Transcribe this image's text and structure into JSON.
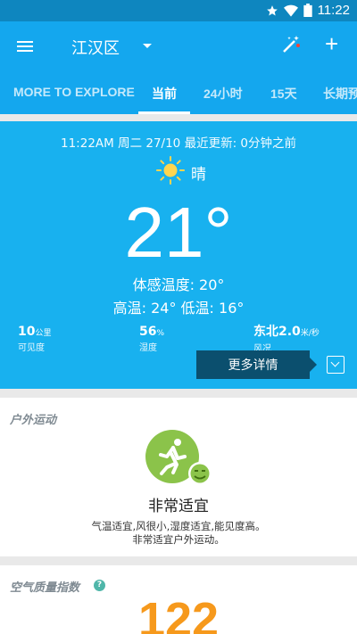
{
  "status_bar": {
    "time": "11:22",
    "icons": [
      "star-icon",
      "wifi-icon",
      "battery-icon"
    ]
  },
  "app_bar": {
    "city": "江汉区",
    "add_label": "+"
  },
  "tabs": [
    {
      "label": "MORE TO EXPLORE",
      "active": false
    },
    {
      "label": "当前",
      "active": true
    },
    {
      "label": "24小时",
      "active": false
    },
    {
      "label": "15天",
      "active": false
    },
    {
      "label": "长期预",
      "active": false
    }
  ],
  "current": {
    "updated": "11:22AM 周二 27/10 最近更新: 0分钟之前",
    "condition": "晴",
    "temperature": "21°",
    "feels_like": "体感温度: 20°",
    "high_low": "高温: 24° 低温: 16°",
    "stats": [
      {
        "value": "10",
        "unit": "公里",
        "label": "可见度"
      },
      {
        "value": "56",
        "unit": "%",
        "label": "湿度"
      },
      {
        "value": "东北2.0",
        "unit": "米/秒",
        "label": "风况"
      }
    ],
    "more_details": "更多详情"
  },
  "outdoor": {
    "title": "户外运动",
    "level": "非常适宜",
    "desc_line1": "气温适宜,风很小,湿度适宜,能见度高。",
    "desc_line2": "非常适宜户外运动。"
  },
  "aqi": {
    "title": "空气质量指数",
    "help": "?",
    "value": "122"
  },
  "colors": {
    "accent": "#14a7ee",
    "hero": "#18b1ef",
    "status": "#0e86bf",
    "aqi": "#f6991c",
    "activity_green": "#8bc34a"
  }
}
